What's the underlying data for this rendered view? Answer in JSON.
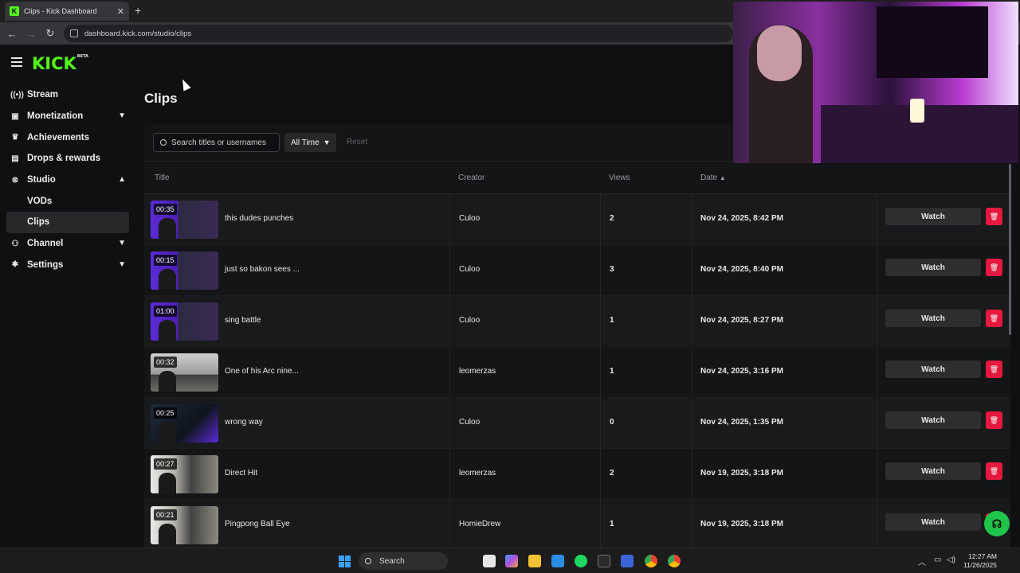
{
  "browser": {
    "tab_title": "Clips - Kick Dashboard",
    "favicon_letter": "K",
    "url": "dashboard.kick.com/studio/clips"
  },
  "brand": {
    "logo": "KICK",
    "logo_badge": "BETA",
    "accent": "#53fc18"
  },
  "sidebar": {
    "items": [
      {
        "label": "Stream",
        "icon": "stream-icon"
      },
      {
        "label": "Monetization",
        "icon": "monetization-icon",
        "chevron": "down"
      },
      {
        "label": "Achievements",
        "icon": "trophy-icon"
      },
      {
        "label": "Drops & rewards",
        "icon": "drops-icon"
      },
      {
        "label": "Studio",
        "icon": "studio-icon",
        "chevron": "up"
      },
      {
        "label": "VODs"
      },
      {
        "label": "Clips",
        "active": true
      },
      {
        "label": "Channel",
        "icon": "channel-icon",
        "chevron": "down"
      },
      {
        "label": "Settings",
        "icon": "gear-icon",
        "chevron": "down"
      }
    ]
  },
  "main": {
    "title": "Clips",
    "search_placeholder": "Search titles or usernames",
    "time_filter": "All Time",
    "reset": "Reset",
    "columns": {
      "title": "Title",
      "creator": "Creator",
      "views": "Views",
      "date": "Date"
    },
    "watch_label": "Watch",
    "rows": [
      {
        "duration": "00:35",
        "title": "this dudes punches",
        "creator": "Culoo",
        "views": "2",
        "date": "Nov 24, 2025, 8:42 PM"
      },
      {
        "duration": "00:15",
        "title": "just so bakon sees ...",
        "creator": "Culoo",
        "views": "3",
        "date": "Nov 24, 2025, 8:40 PM"
      },
      {
        "duration": "01:00",
        "title": "sing battle",
        "creator": "Culoo",
        "views": "1",
        "date": "Nov 24, 2025, 8:27 PM"
      },
      {
        "duration": "00:32",
        "title": "One of his Arc nine...",
        "creator": "leomerzas",
        "views": "1",
        "date": "Nov 24, 2025, 3:16 PM"
      },
      {
        "duration": "00:25",
        "title": "wrong way",
        "creator": "Culoo",
        "views": "0",
        "date": "Nov 24, 2025, 1:35 PM"
      },
      {
        "duration": "00:27",
        "title": "Direct Hit",
        "creator": "leomerzas",
        "views": "2",
        "date": "Nov 19, 2025, 3:18 PM"
      },
      {
        "duration": "00:21",
        "title": "Pingpong Ball Eye",
        "creator": "HomieDrew",
        "views": "1",
        "date": "Nov 19, 2025, 3:18 PM"
      }
    ]
  },
  "taskbar": {
    "search": "Search",
    "time": "12:27 AM",
    "date": "11/26/2025"
  }
}
